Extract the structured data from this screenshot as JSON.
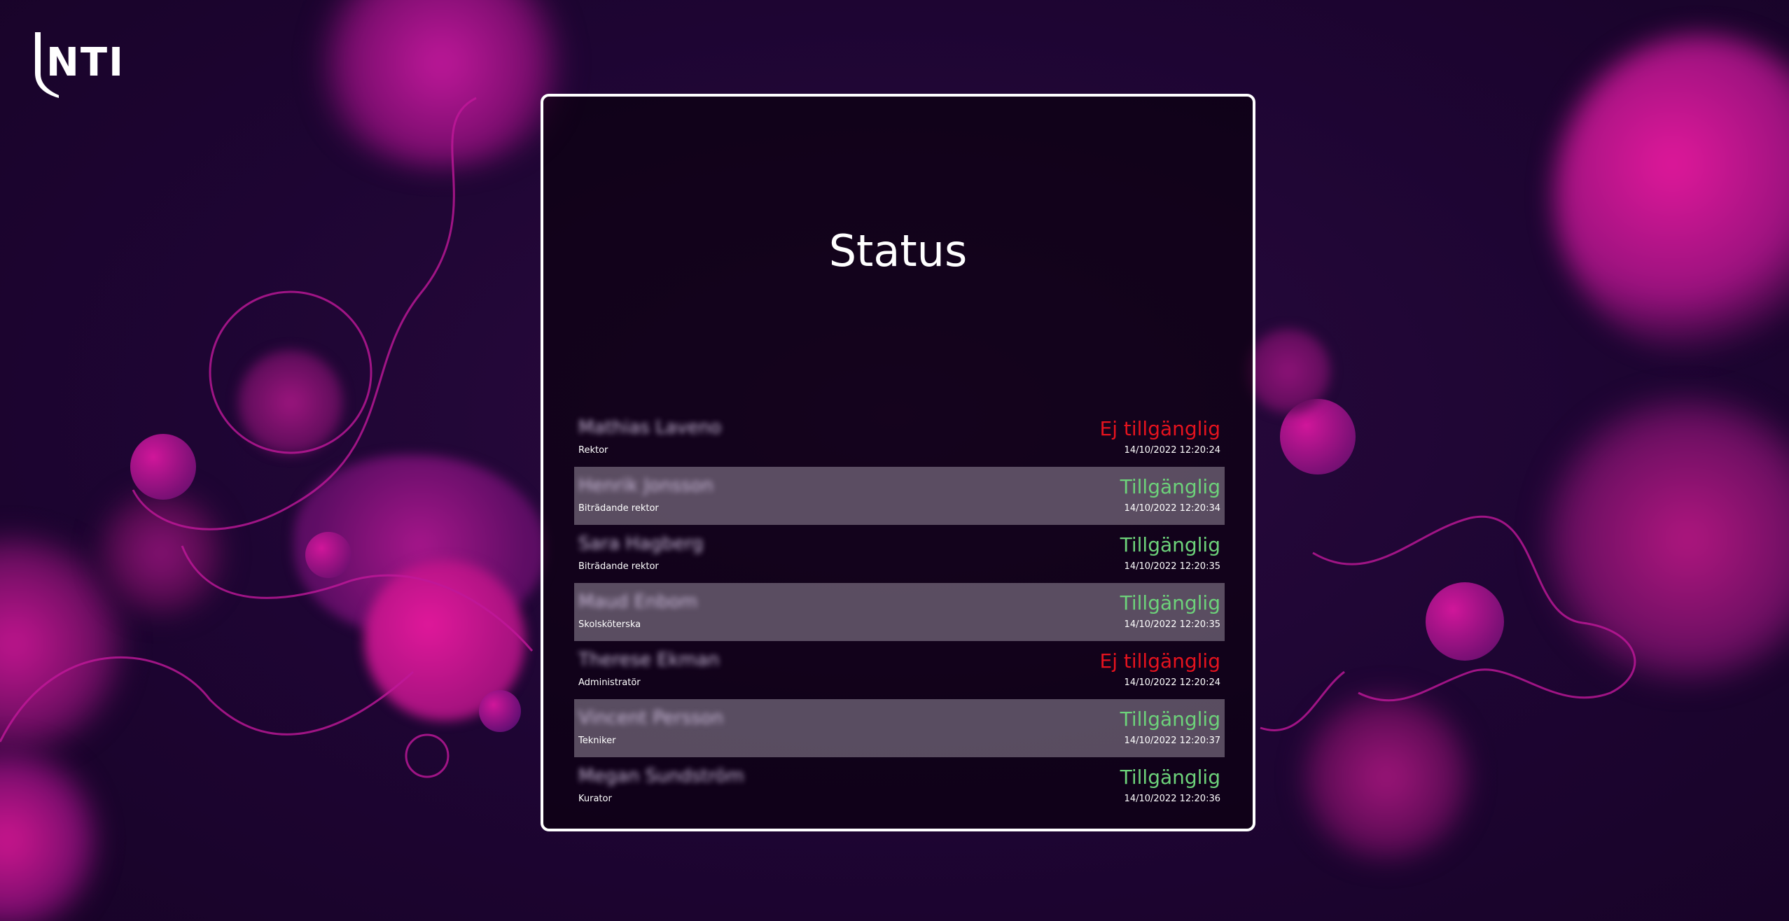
{
  "logo": {
    "text": "NTI"
  },
  "page": {
    "title": "Status"
  },
  "colors": {
    "background": "#1e0533",
    "accent_magenta": "#e0189a",
    "available": "#6dd27a",
    "unavailable": "#e5131e"
  },
  "staff": [
    {
      "name": "Mathias Laveno",
      "role": "Rektor",
      "status": "Ej tillgänglig",
      "state": "unavailable",
      "timestamp": "14/10/2022 12:20:24"
    },
    {
      "name": "Henrik Jonsson",
      "role": "Biträdande rektor",
      "status": "Tillgänglig",
      "state": "available",
      "timestamp": "14/10/2022 12:20:34"
    },
    {
      "name": "Sara Hagberg",
      "role": "Biträdande rektor",
      "status": "Tillgänglig",
      "state": "available",
      "timestamp": "14/10/2022 12:20:35"
    },
    {
      "name": "Maud Enbom",
      "role": "Skolsköterska",
      "status": "Tillgänglig",
      "state": "available",
      "timestamp": "14/10/2022 12:20:35"
    },
    {
      "name": "Therese Ekman",
      "role": "Administratör",
      "status": "Ej tillgänglig",
      "state": "unavailable",
      "timestamp": "14/10/2022 12:20:24"
    },
    {
      "name": "Vincent Persson",
      "role": "Tekniker",
      "status": "Tillgänglig",
      "state": "available",
      "timestamp": "14/10/2022 12:20:37"
    },
    {
      "name": "Megan Sundström",
      "role": "Kurator",
      "status": "Tillgänglig",
      "state": "available",
      "timestamp": "14/10/2022 12:20:36"
    }
  ]
}
